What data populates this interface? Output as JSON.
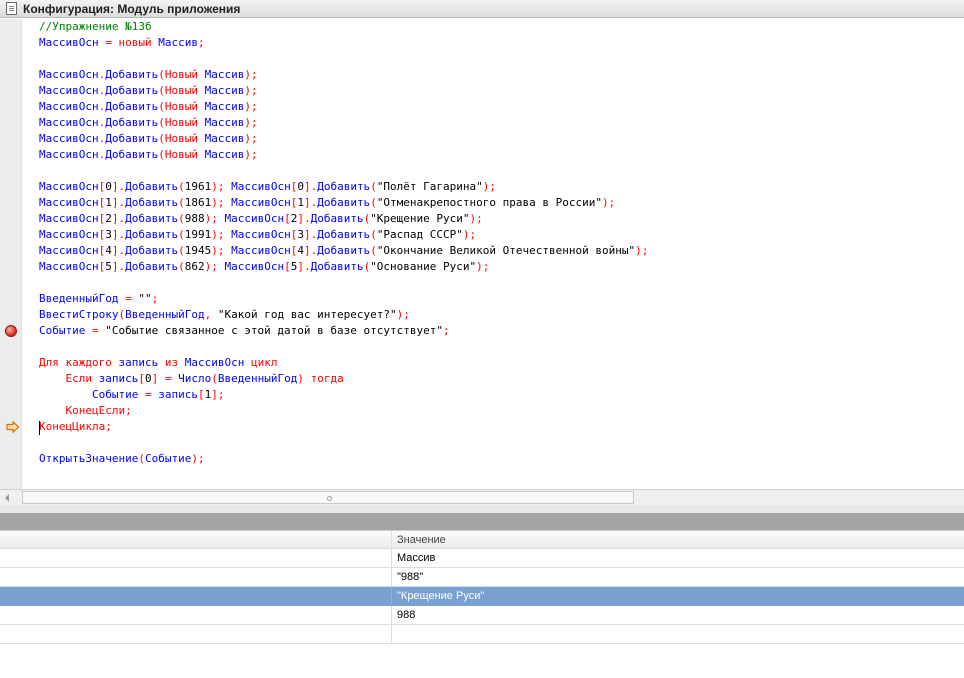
{
  "window": {
    "title": "Конфигурация: Модуль приложения"
  },
  "editor": {
    "lines": [
      [
        [
          "cm",
          "//Упражнение №13б"
        ]
      ],
      [
        [
          "id",
          "МассивОсн"
        ],
        [
          "op",
          " = "
        ],
        [
          "kw",
          "новый"
        ],
        [
          "ws",
          " "
        ],
        [
          "id",
          "Массив"
        ],
        [
          "op",
          ";"
        ]
      ],
      [],
      [
        [
          "id",
          "МассивОсн"
        ],
        [
          "op",
          "."
        ],
        [
          "id",
          "Добавить"
        ],
        [
          "op",
          "("
        ],
        [
          "kw",
          "Новый"
        ],
        [
          "ws",
          " "
        ],
        [
          "id",
          "Массив"
        ],
        [
          "op",
          ");"
        ]
      ],
      [
        [
          "id",
          "МассивОсн"
        ],
        [
          "op",
          "."
        ],
        [
          "id",
          "Добавить"
        ],
        [
          "op",
          "("
        ],
        [
          "kw",
          "Новый"
        ],
        [
          "ws",
          " "
        ],
        [
          "id",
          "Массив"
        ],
        [
          "op",
          ");"
        ]
      ],
      [
        [
          "id",
          "МассивОсн"
        ],
        [
          "op",
          "."
        ],
        [
          "id",
          "Добавить"
        ],
        [
          "op",
          "("
        ],
        [
          "kw",
          "Новый"
        ],
        [
          "ws",
          " "
        ],
        [
          "id",
          "Массив"
        ],
        [
          "op",
          ");"
        ]
      ],
      [
        [
          "id",
          "МассивОсн"
        ],
        [
          "op",
          "."
        ],
        [
          "id",
          "Добавить"
        ],
        [
          "op",
          "("
        ],
        [
          "kw",
          "Новый"
        ],
        [
          "ws",
          " "
        ],
        [
          "id",
          "Массив"
        ],
        [
          "op",
          ");"
        ]
      ],
      [
        [
          "id",
          "МассивОсн"
        ],
        [
          "op",
          "."
        ],
        [
          "id",
          "Добавить"
        ],
        [
          "op",
          "("
        ],
        [
          "kw",
          "Новый"
        ],
        [
          "ws",
          " "
        ],
        [
          "id",
          "Массив"
        ],
        [
          "op",
          ");"
        ]
      ],
      [
        [
          "id",
          "МассивОсн"
        ],
        [
          "op",
          "."
        ],
        [
          "id",
          "Добавить"
        ],
        [
          "op",
          "("
        ],
        [
          "kw",
          "Новый"
        ],
        [
          "ws",
          " "
        ],
        [
          "id",
          "Массив"
        ],
        [
          "op",
          ");"
        ]
      ],
      [],
      [
        [
          "id",
          "МассивОсн"
        ],
        [
          "op",
          "["
        ],
        [
          "num",
          "0"
        ],
        [
          "op",
          "]."
        ],
        [
          "id",
          "Добавить"
        ],
        [
          "op",
          "("
        ],
        [
          "num",
          "1961"
        ],
        [
          "op",
          ");"
        ],
        [
          "ws",
          " "
        ],
        [
          "id",
          "МассивОсн"
        ],
        [
          "op",
          "["
        ],
        [
          "num",
          "0"
        ],
        [
          "op",
          "]."
        ],
        [
          "id",
          "Добавить"
        ],
        [
          "op",
          "("
        ],
        [
          "str",
          "\"Полёт Гагарина\""
        ],
        [
          "op",
          ");"
        ]
      ],
      [
        [
          "id",
          "МассивОсн"
        ],
        [
          "op",
          "["
        ],
        [
          "num",
          "1"
        ],
        [
          "op",
          "]."
        ],
        [
          "id",
          "Добавить"
        ],
        [
          "op",
          "("
        ],
        [
          "num",
          "1861"
        ],
        [
          "op",
          ");"
        ],
        [
          "ws",
          " "
        ],
        [
          "id",
          "МассивОсн"
        ],
        [
          "op",
          "["
        ],
        [
          "num",
          "1"
        ],
        [
          "op",
          "]."
        ],
        [
          "id",
          "Добавить"
        ],
        [
          "op",
          "("
        ],
        [
          "str",
          "\"Отменакрепостного права в России\""
        ],
        [
          "op",
          ");"
        ]
      ],
      [
        [
          "id",
          "МассивОсн"
        ],
        [
          "op",
          "["
        ],
        [
          "num",
          "2"
        ],
        [
          "op",
          "]."
        ],
        [
          "id",
          "Добавить"
        ],
        [
          "op",
          "("
        ],
        [
          "num",
          "988"
        ],
        [
          "op",
          ");"
        ],
        [
          "ws",
          " "
        ],
        [
          "id",
          "МассивОсн"
        ],
        [
          "op",
          "["
        ],
        [
          "num",
          "2"
        ],
        [
          "op",
          "]."
        ],
        [
          "id",
          "Добавить"
        ],
        [
          "op",
          "("
        ],
        [
          "str",
          "\"Крещение Руси\""
        ],
        [
          "op",
          ");"
        ]
      ],
      [
        [
          "id",
          "МассивОсн"
        ],
        [
          "op",
          "["
        ],
        [
          "num",
          "3"
        ],
        [
          "op",
          "]."
        ],
        [
          "id",
          "Добавить"
        ],
        [
          "op",
          "("
        ],
        [
          "num",
          "1991"
        ],
        [
          "op",
          ");"
        ],
        [
          "ws",
          " "
        ],
        [
          "id",
          "МассивОсн"
        ],
        [
          "op",
          "["
        ],
        [
          "num",
          "3"
        ],
        [
          "op",
          "]."
        ],
        [
          "id",
          "Добавить"
        ],
        [
          "op",
          "("
        ],
        [
          "str",
          "\"Распад СССР\""
        ],
        [
          "op",
          ");"
        ]
      ],
      [
        [
          "id",
          "МассивОсн"
        ],
        [
          "op",
          "["
        ],
        [
          "num",
          "4"
        ],
        [
          "op",
          "]."
        ],
        [
          "id",
          "Добавить"
        ],
        [
          "op",
          "("
        ],
        [
          "num",
          "1945"
        ],
        [
          "op",
          ");"
        ],
        [
          "ws",
          " "
        ],
        [
          "id",
          "МассивОсн"
        ],
        [
          "op",
          "["
        ],
        [
          "num",
          "4"
        ],
        [
          "op",
          "]."
        ],
        [
          "id",
          "Добавить"
        ],
        [
          "op",
          "("
        ],
        [
          "str",
          "\"Окончание Великой Отечественной войны\""
        ],
        [
          "op",
          ");"
        ]
      ],
      [
        [
          "id",
          "МассивОсн"
        ],
        [
          "op",
          "["
        ],
        [
          "num",
          "5"
        ],
        [
          "op",
          "]."
        ],
        [
          "id",
          "Добавить"
        ],
        [
          "op",
          "("
        ],
        [
          "num",
          "862"
        ],
        [
          "op",
          ");"
        ],
        [
          "ws",
          " "
        ],
        [
          "id",
          "МассивОсн"
        ],
        [
          "op",
          "["
        ],
        [
          "num",
          "5"
        ],
        [
          "op",
          "]."
        ],
        [
          "id",
          "Добавить"
        ],
        [
          "op",
          "("
        ],
        [
          "str",
          "\"Основание Руси\""
        ],
        [
          "op",
          ");"
        ]
      ],
      [],
      [
        [
          "id",
          "ВведенныйГод"
        ],
        [
          "op",
          " = "
        ],
        [
          "str",
          "\"\""
        ],
        [
          "op",
          ";"
        ]
      ],
      [
        [
          "id",
          "ВвестиСтроку"
        ],
        [
          "op",
          "("
        ],
        [
          "id",
          "ВведенныйГод"
        ],
        [
          "op",
          ", "
        ],
        [
          "str",
          "\"Какой год вас интересует?\""
        ],
        [
          "op",
          ");"
        ]
      ],
      [
        [
          "id",
          "Событие"
        ],
        [
          "op",
          " = "
        ],
        [
          "str",
          "\"Событие связанное с этой датой в базе отсутствует\""
        ],
        [
          "op",
          ";"
        ]
      ],
      [],
      [
        [
          "kw",
          "Для"
        ],
        [
          "ws",
          " "
        ],
        [
          "kw",
          "каждого"
        ],
        [
          "ws",
          " "
        ],
        [
          "id",
          "запись"
        ],
        [
          "ws",
          " "
        ],
        [
          "kw",
          "из"
        ],
        [
          "ws",
          " "
        ],
        [
          "id",
          "МассивОсн"
        ],
        [
          "ws",
          " "
        ],
        [
          "kw",
          "цикл"
        ]
      ],
      [
        [
          "ws",
          "    "
        ],
        [
          "kw",
          "Если"
        ],
        [
          "ws",
          " "
        ],
        [
          "id",
          "запись"
        ],
        [
          "op",
          "["
        ],
        [
          "num",
          "0"
        ],
        [
          "op",
          "] = "
        ],
        [
          "id",
          "Число"
        ],
        [
          "op",
          "("
        ],
        [
          "id",
          "ВведенныйГод"
        ],
        [
          "op",
          ")"
        ],
        [
          "ws",
          " "
        ],
        [
          "kw",
          "тогда"
        ]
      ],
      [
        [
          "ws",
          "        "
        ],
        [
          "id",
          "Событие"
        ],
        [
          "op",
          " = "
        ],
        [
          "id",
          "запись"
        ],
        [
          "op",
          "["
        ],
        [
          "num",
          "1"
        ],
        [
          "op",
          "];"
        ]
      ],
      [
        [
          "ws",
          "    "
        ],
        [
          "kw",
          "КонецЕсли"
        ],
        [
          "op",
          ";"
        ]
      ],
      [
        [
          "kw",
          "КонецЦикла"
        ],
        [
          "op",
          ";"
        ]
      ],
      [],
      [
        [
          "id",
          "ОткрытьЗначение"
        ],
        [
          "op",
          "("
        ],
        [
          "id",
          "Событие"
        ],
        [
          "op",
          ");"
        ]
      ]
    ]
  },
  "watch": {
    "header": "Значение",
    "rows": [
      "Массив",
      "\"988\"",
      "\"Крещение Руси\"",
      "988",
      ""
    ],
    "selected_index": 2
  },
  "colors": {
    "keyword": "#ff0000",
    "operator": "#ff0000",
    "identifier": "#0000ff",
    "string": "#000000",
    "number": "#000000",
    "comment": "#008000",
    "selection": "#7aa0d2",
    "breakpoint": "#e04030",
    "current_line_marker": "#e08020"
  }
}
